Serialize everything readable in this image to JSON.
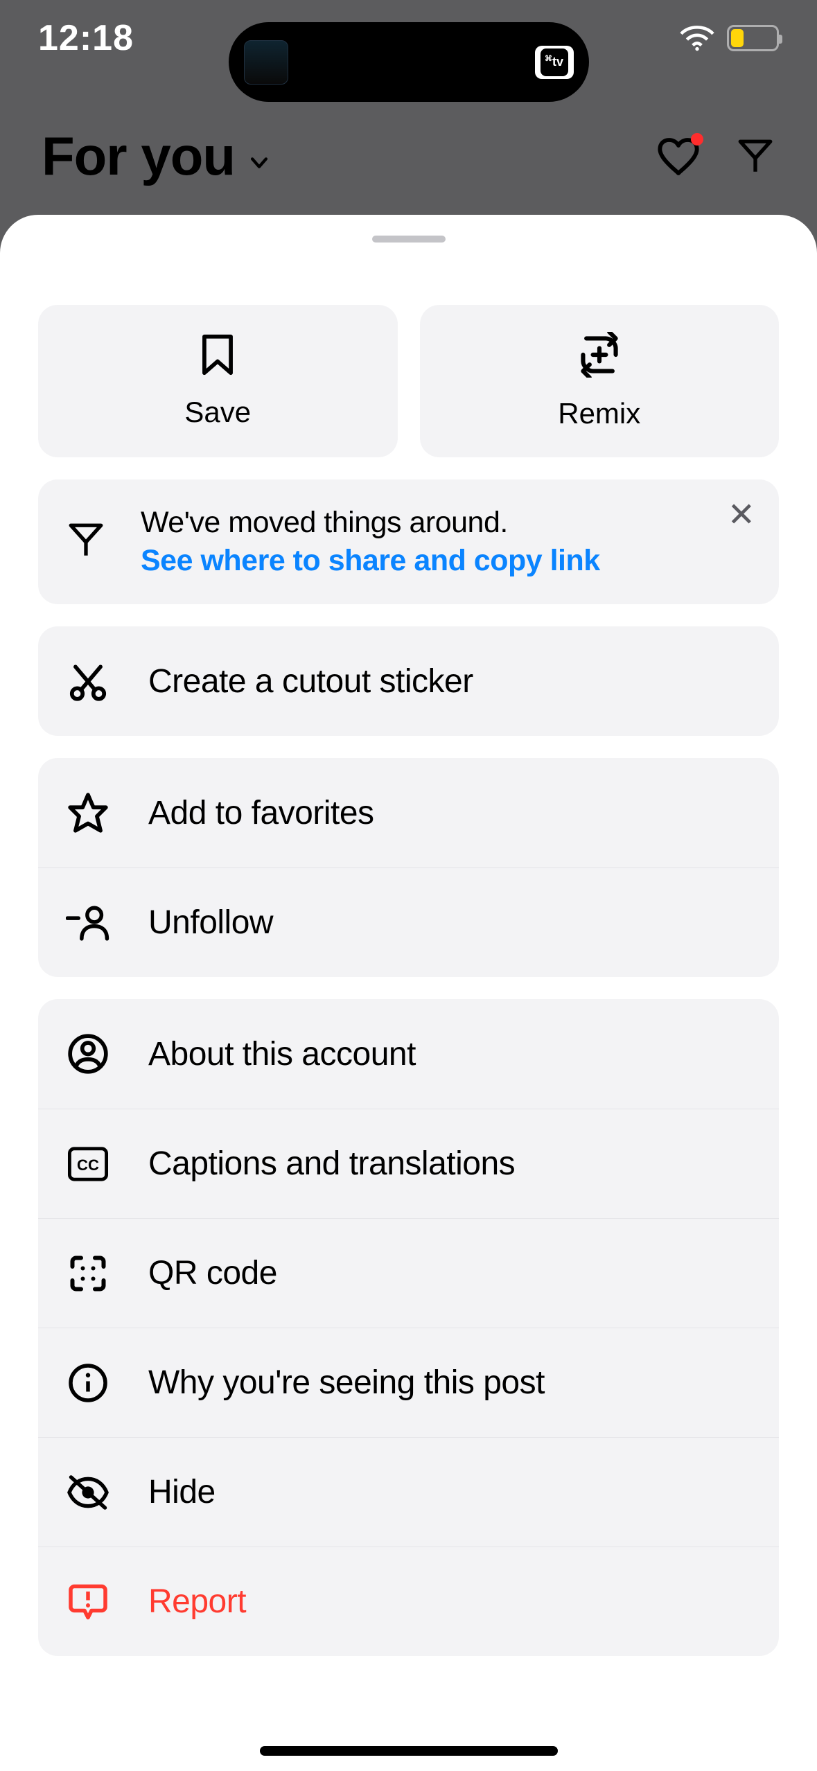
{
  "status": {
    "time": "12:18",
    "island_right_label": "tv"
  },
  "header": {
    "title": "For you"
  },
  "sheet": {
    "pills": [
      {
        "label": "Save"
      },
      {
        "label": "Remix"
      }
    ],
    "info": {
      "line1": "We've moved things around.",
      "link": "See where to share and copy link"
    },
    "group1": [
      {
        "label": "Create a cutout sticker"
      }
    ],
    "group2": [
      {
        "label": "Add to favorites"
      },
      {
        "label": "Unfollow"
      }
    ],
    "group3": [
      {
        "label": "About this account"
      },
      {
        "label": "Captions and translations"
      },
      {
        "label": "QR code"
      },
      {
        "label": "Why you're seeing this post"
      },
      {
        "label": "Hide"
      },
      {
        "label": "Report"
      }
    ]
  }
}
